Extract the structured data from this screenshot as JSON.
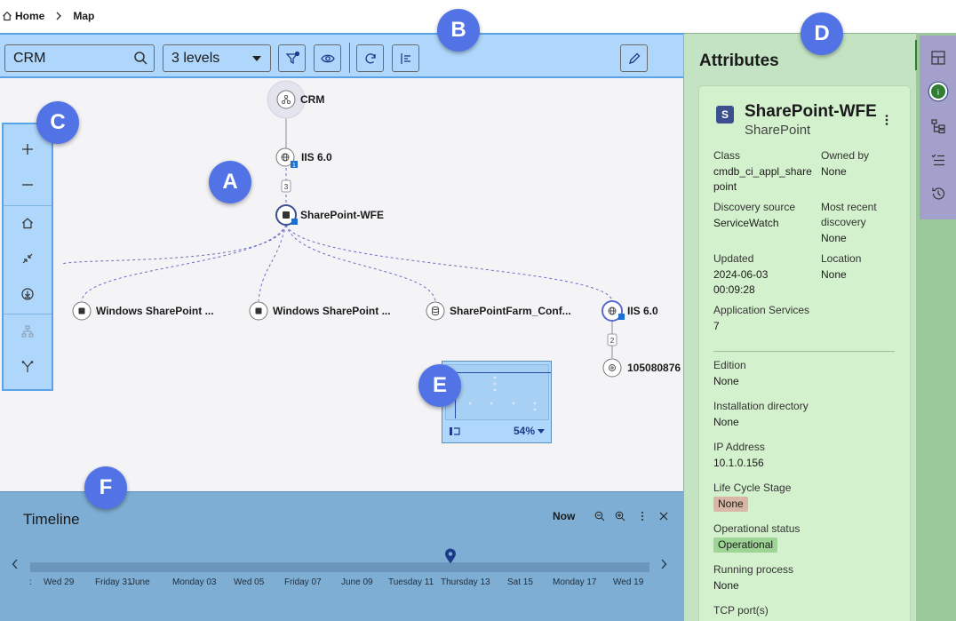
{
  "breadcrumb": {
    "home": "Home",
    "current": "Map"
  },
  "toolbar": {
    "ci_search_value": "CRM",
    "levels_value": "3 levels"
  },
  "map": {
    "nodes": [
      {
        "label": "CRM"
      },
      {
        "label": "IIS 6.0",
        "badge": "1"
      },
      {
        "label": "SharePoint-WFE"
      },
      {
        "label": "Windows SharePoint ..."
      },
      {
        "label": "Windows SharePoint ..."
      },
      {
        "label": "SharePointFarm_Conf..."
      },
      {
        "label": "IIS 6.0"
      },
      {
        "label": "105080876"
      }
    ],
    "edge_counts": [
      "3",
      "2"
    ]
  },
  "minimap": {
    "zoom": "54%"
  },
  "timeline": {
    "title": "Timeline",
    "now_label": "Now",
    "ticks": [
      "Wed 29",
      "Friday 31",
      "June",
      "Monday 03",
      "Wed 05",
      "Friday 07",
      "June 09",
      "Tuesday 11",
      "Thursday 13",
      "Sat 15",
      "Monday 17",
      "Wed 19"
    ]
  },
  "attributes": {
    "panel_title": "Attributes",
    "ci": {
      "badge": "S",
      "name": "SharePoint-WFE",
      "type": "SharePoint"
    },
    "fields": {
      "class": {
        "label": "Class",
        "value": "cmdb_ci_appl_share\npoint"
      },
      "owned_by": {
        "label": "Owned by",
        "value": "None"
      },
      "discovery_source": {
        "label": "Discovery source",
        "value": "ServiceWatch"
      },
      "most_recent_discovery": {
        "label": "Most recent\ndiscovery",
        "value": "None"
      },
      "updated": {
        "label": "Updated",
        "value": "2024-06-03\n00:09:28"
      },
      "location": {
        "label": "Location",
        "value": "None"
      },
      "application_services": {
        "label": "Application Services",
        "value": "7"
      },
      "edition": {
        "label": "Edition",
        "value": "None"
      },
      "installation_directory": {
        "label": "Installation directory",
        "value": "None"
      },
      "ip_address": {
        "label": "IP Address",
        "value": "10.1.0.156"
      },
      "life_cycle_stage": {
        "label": "Life Cycle Stage",
        "value": "None"
      },
      "operational_status": {
        "label": "Operational status",
        "value": "Operational"
      },
      "running_process": {
        "label": "Running process",
        "value": "None"
      },
      "tcp_ports": {
        "label": "TCP port(s)"
      }
    }
  },
  "callouts": {
    "a": "A",
    "b": "B",
    "c": "C",
    "d": "D",
    "e": "E",
    "f": "F"
  },
  "colors": {
    "map_bg": "#f4f4f7",
    "toolbar_bg": "#aed7fb",
    "attributes_bg": "#c3e3c3",
    "timeline_bg": "#7eaed3",
    "marker": "#5273e6",
    "node_accent": "#3b4f8f",
    "life_cycle_pill": "#d9b7a6",
    "operational_pill": "#9fd497"
  }
}
